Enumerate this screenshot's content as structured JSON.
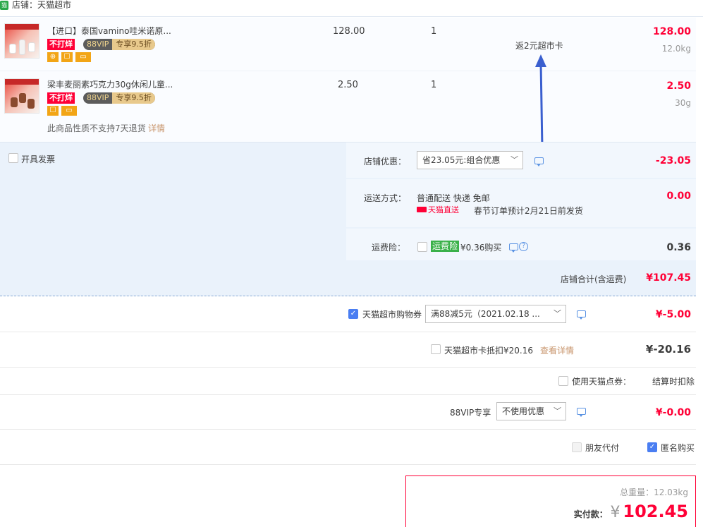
{
  "shop": {
    "label": "店铺：天猫超市",
    "icon": "tmall-market-icon"
  },
  "items": [
    {
      "title": "【进口】泰国vamino哇米诺原...",
      "tags": {
        "no_discount": "不打烊",
        "vip_left": "88VIP",
        "vip_right": "专享9.5折"
      },
      "unit_price": "128.00",
      "quantity": "1",
      "subtotal": "128.00",
      "weight": "12.0kg"
    },
    {
      "title": "梁丰麦丽素巧克力30g休闲儿童...",
      "tags": {
        "no_discount": "不打烊",
        "vip_left": "88VIP",
        "vip_right": "专享9.5折"
      },
      "unit_price": "2.50",
      "quantity": "1",
      "subtotal": "2.50",
      "weight": "30g",
      "return_note": "此商品性质不支持7天退货",
      "return_link": "详情"
    }
  ],
  "card_note": "返2元超市卡",
  "invoice": {
    "label": "开具发票",
    "checked": false
  },
  "shop_discount": {
    "label": "店铺优惠：",
    "value": "省23.05元:组合优惠",
    "amount": "-23.05"
  },
  "shipping": {
    "label": "运送方式：",
    "value": "普通配送 快递 免邮",
    "badge": "天猫直送",
    "note": "春节订单预计2月21日前发货",
    "amount": "0.00"
  },
  "insurance": {
    "label": "运费险：",
    "tag": "运费险",
    "price": "¥0.36购买",
    "amount": "0.36",
    "checked": false
  },
  "shop_total": {
    "label": "店铺合计(含运费)",
    "amount": "¥107.45"
  },
  "coupon": {
    "label": "天猫超市购物券",
    "value": "满88减5元（2021.02.18 ...",
    "amount": "¥-5.00",
    "checked": true
  },
  "card": {
    "label": "天猫超市卡抵扣¥20.16",
    "link": "查看详情",
    "amount": "¥-20.16",
    "checked": false
  },
  "points": {
    "label": "使用天猫点券：",
    "note": "结算时扣除",
    "checked": false
  },
  "vip": {
    "label": "88VIP专享",
    "value": "不使用优惠",
    "amount": "¥-0.00"
  },
  "friend_pay": {
    "label": "朋友代付",
    "checked": false,
    "disabled": true
  },
  "anonymous": {
    "label": "匿名购买",
    "checked": true
  },
  "summary": {
    "weight_label": "总重量：",
    "weight": "12.03kg",
    "pay_label": "实付款：",
    "currency": "¥",
    "total": "102.45"
  },
  "colors": {
    "price_red": "#ff0036",
    "accent_blue": "#4a7ef2",
    "panel_blue": "#eaf2fb"
  }
}
